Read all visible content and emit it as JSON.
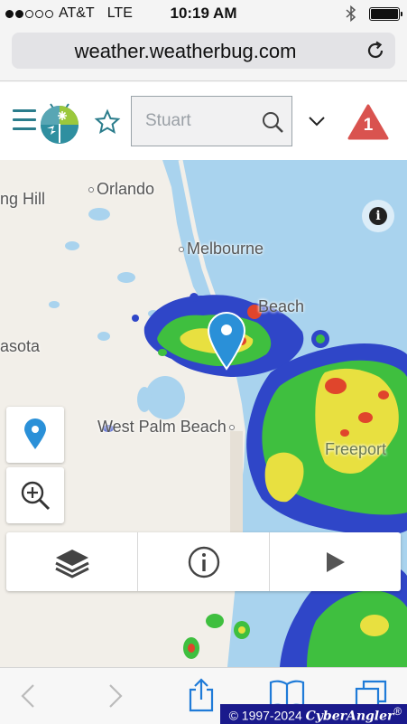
{
  "status_bar": {
    "carrier": "AT&T",
    "network": "LTE",
    "time": "10:19 AM",
    "signal_bars_filled": 2,
    "signal_bars_total": 5,
    "bluetooth_icon": "bluetooth-icon",
    "battery_icon": "battery-full-icon"
  },
  "browser": {
    "url": "weather.weatherbug.com",
    "reload_icon": "reload-icon"
  },
  "app_header": {
    "menu_icon": "hamburger-menu-icon",
    "logo_icon": "weatherbug-logo-icon",
    "favorite_icon": "star-icon",
    "search": {
      "placeholder": "Stuart",
      "value": ""
    },
    "search_icon": "magnifier-icon",
    "dropdown_icon": "chevron-down-icon",
    "alert_count": "1",
    "alert_color": "#d9534f"
  },
  "map": {
    "cities": {
      "orlando": "Orlando",
      "winter_haven": "ng Hill",
      "melbourne": "Melbourne",
      "vero_beach": "Beach",
      "sarasota": "asota",
      "west_palm_beach": "West Palm Beach",
      "freeport": "Freeport"
    },
    "info_icon": "info-icon",
    "location_pin_icon": "map-pin-icon",
    "pin_color": "#2a90d8",
    "controls": {
      "locate_icon": "location-pin-icon",
      "zoom_icon": "zoom-in-icon"
    },
    "toolbar": {
      "layers_icon": "layers-icon",
      "legend_icon": "info-circle-icon",
      "play_icon": "play-icon"
    },
    "colors": {
      "water": "#a9d3ee",
      "land": "#f2efe9",
      "radar_blue": "#2f46c8",
      "radar_green": "#3fbf3f",
      "radar_yellow": "#e8e040",
      "radar_red": "#e0452c"
    }
  },
  "bottom_bar": {
    "back_icon": "back-chevron-icon",
    "forward_icon": "forward-chevron-icon",
    "share_icon": "share-icon",
    "bookmarks_icon": "bookmarks-icon",
    "tabs_icon": "tabs-icon",
    "watermark": {
      "years": "© 1997-2024",
      "brand": "CyberAngler",
      "mark": "®"
    }
  }
}
